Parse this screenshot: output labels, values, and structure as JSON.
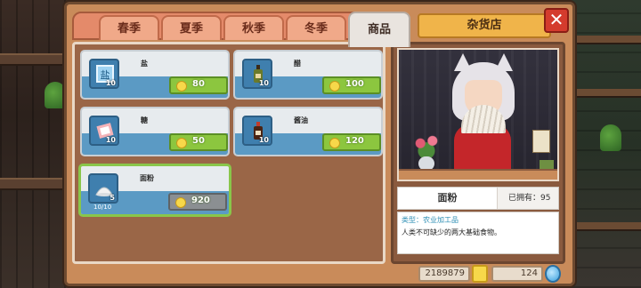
{
  "tabs": [
    {
      "label": "春季"
    },
    {
      "label": "夏季"
    },
    {
      "label": "秋季"
    },
    {
      "label": "冬季"
    },
    {
      "label": "商品"
    }
  ],
  "shop_title": "杂货店",
  "close_label": "✕",
  "items": [
    {
      "name": "盐",
      "qty": "10",
      "price": "80",
      "icon": "salt-box-icon"
    },
    {
      "name": "醋",
      "qty": "10",
      "price": "100",
      "icon": "vinegar-bottle-icon"
    },
    {
      "name": "糖",
      "qty": "10",
      "price": "50",
      "icon": "sugar-bag-icon"
    },
    {
      "name": "酱油",
      "qty": "10",
      "price": "120",
      "icon": "soy-sauce-bottle-icon"
    },
    {
      "name": "面粉",
      "qty": "5",
      "price": "920",
      "stock": "10/10",
      "icon": "flour-pile-icon"
    }
  ],
  "detail": {
    "item_name": "面粉",
    "owned": "已拥有：95",
    "type": "类型：农业加工品",
    "description": "人类不可缺少的两大基础食物。"
  },
  "currency": {
    "coins": "2189879",
    "gems": "124"
  },
  "colors": {
    "price_green": "#8cc63f",
    "price_gray": "#8b8f92",
    "selected_border": "#89c64a",
    "close_red": "#d43b2d"
  }
}
